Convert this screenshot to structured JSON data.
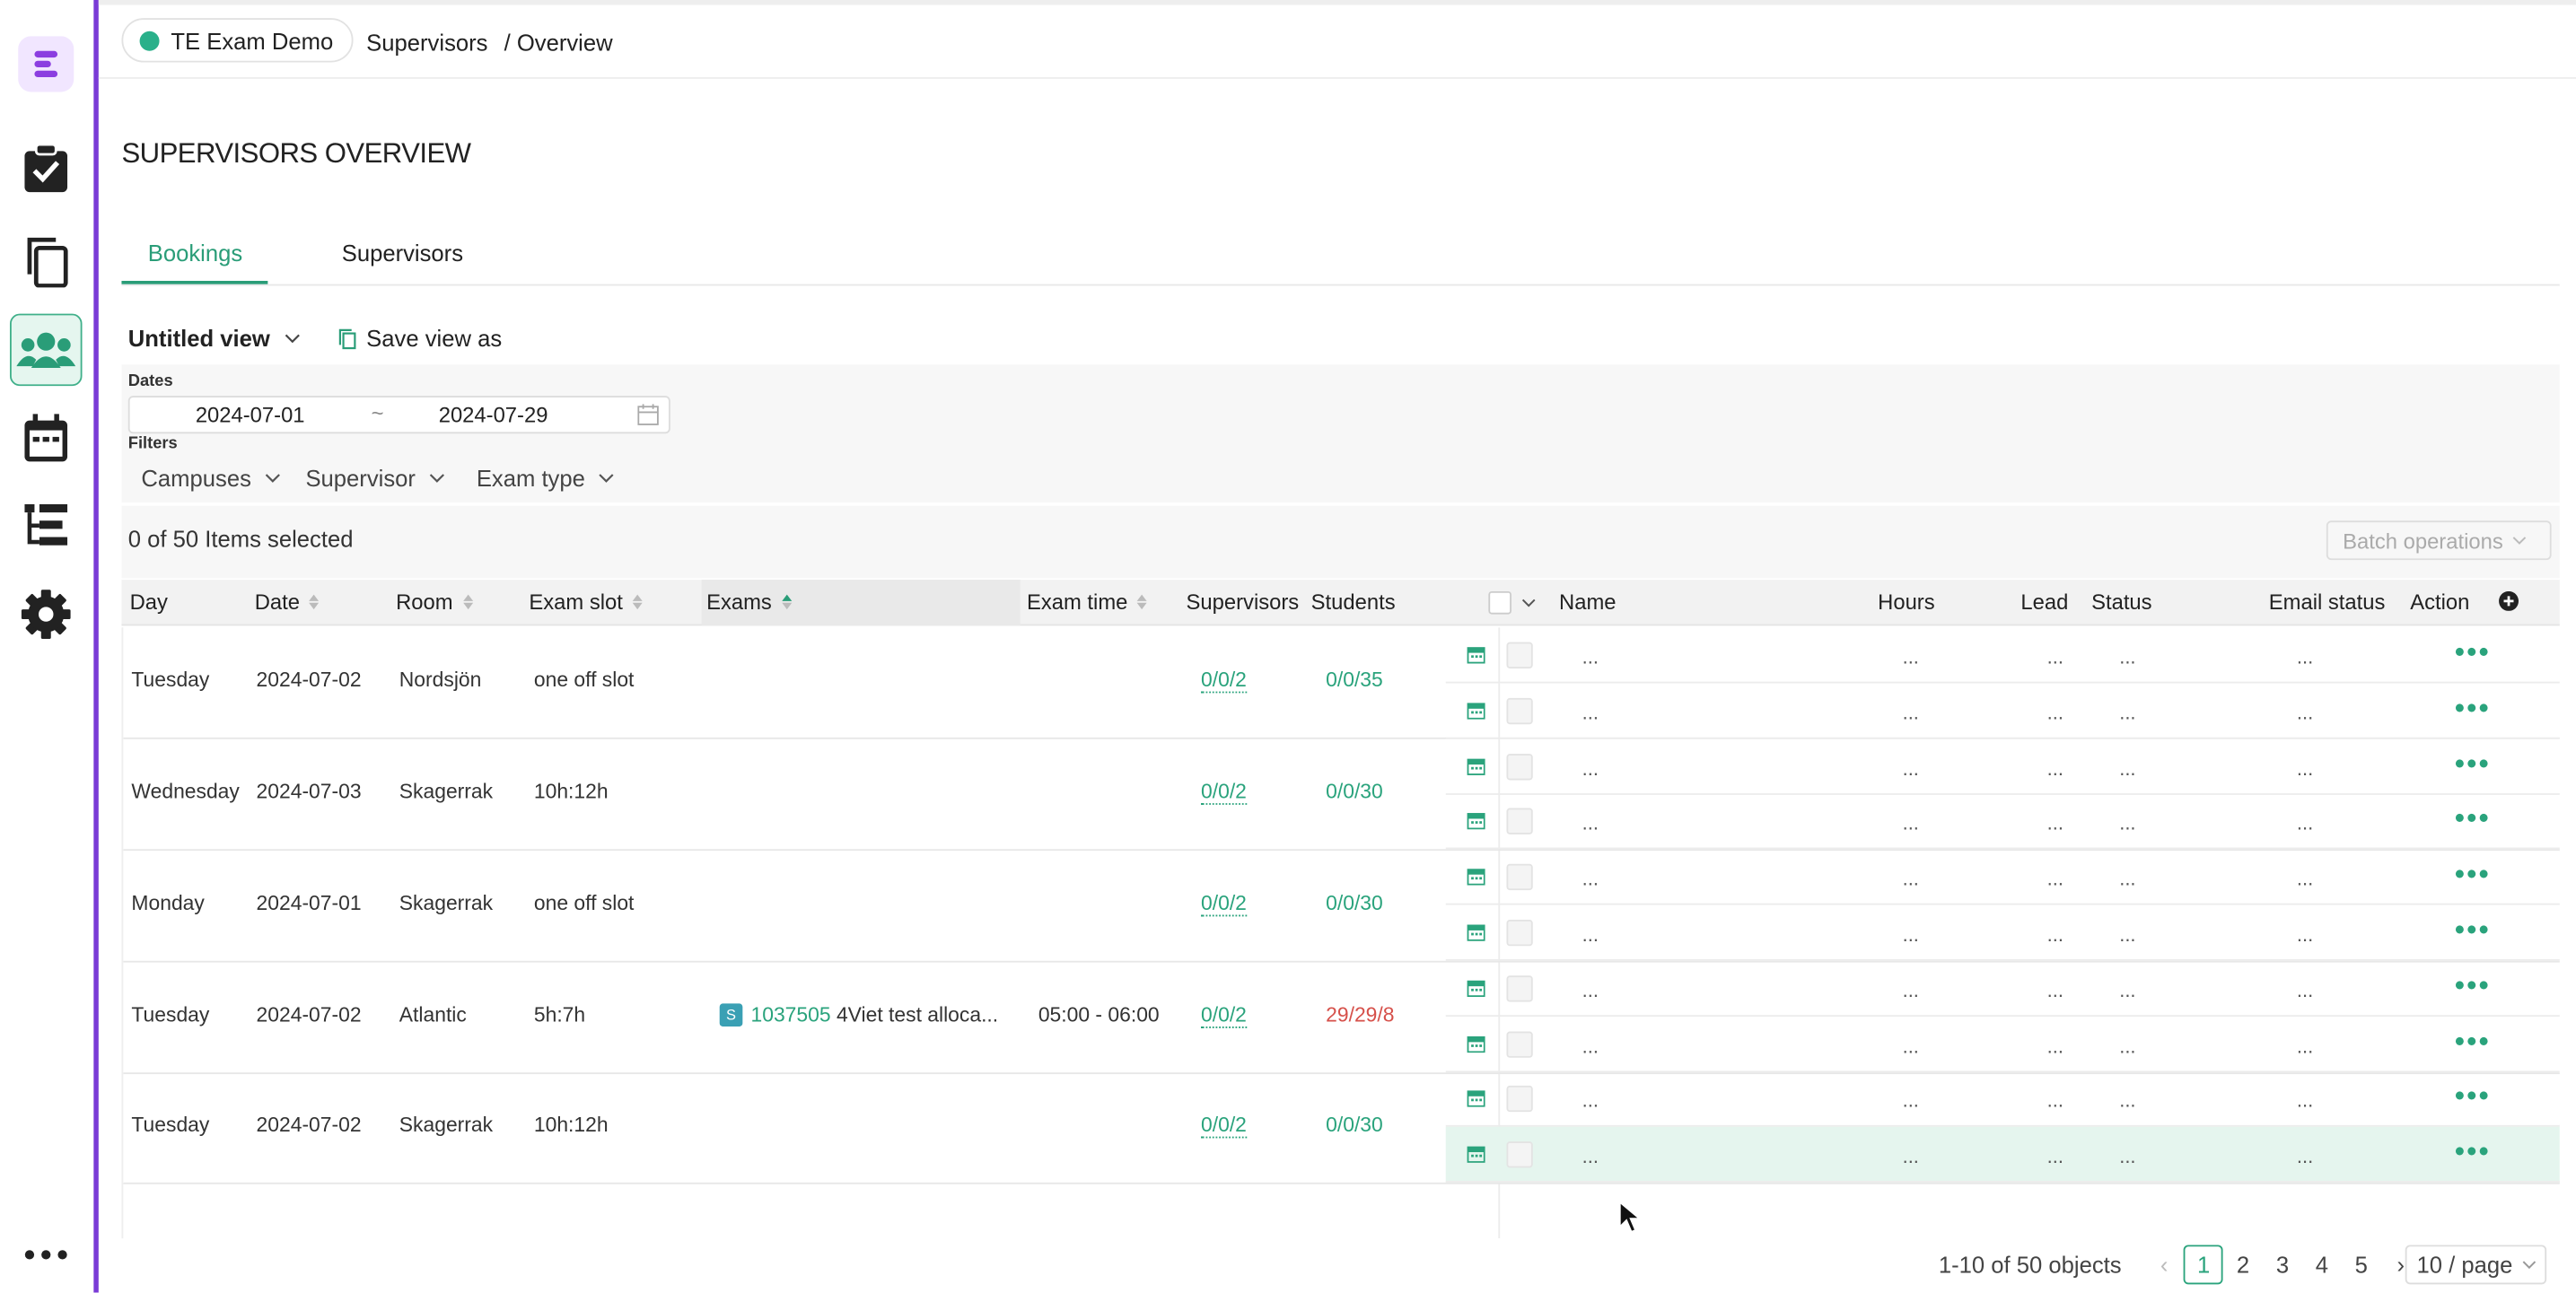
{
  "header": {
    "app_name": "TE Exam Demo",
    "breadcrumb": [
      "Supervisors",
      "/ Overview"
    ]
  },
  "sidebar": {
    "items": [
      {
        "name": "logo",
        "icon": "app-logo-icon"
      },
      {
        "name": "exams",
        "icon": "clipboard-check-icon"
      },
      {
        "name": "copies",
        "icon": "copy-icon"
      },
      {
        "name": "supervisors",
        "icon": "users-icon",
        "active": true
      },
      {
        "name": "calendar",
        "icon": "calendar-icon"
      },
      {
        "name": "hierarchy",
        "icon": "tree-list-icon"
      },
      {
        "name": "settings",
        "icon": "gear-icon"
      },
      {
        "name": "more",
        "icon": "more-icon"
      }
    ]
  },
  "page": {
    "title": "SUPERVISORS OVERVIEW",
    "tabs": [
      {
        "label": "Bookings",
        "active": true
      },
      {
        "label": "Supervisors",
        "active": false
      }
    ]
  },
  "view": {
    "name": "Untitled view",
    "save_label": "Save view as"
  },
  "filters": {
    "dates_label": "Dates",
    "date_from": "2024-07-01",
    "date_sep": "~",
    "date_to": "2024-07-29",
    "filters_label": "Filters",
    "selects": [
      "Campuses",
      "Supervisor",
      "Exam type"
    ]
  },
  "selection": {
    "text": "0 of 50 Items selected",
    "batch_label": "Batch operations"
  },
  "table": {
    "columns": [
      "Day",
      "Date",
      "Room",
      "Exam slot",
      "Exams",
      "Exam time",
      "Supervisors",
      "Students",
      "Name",
      "Hours",
      "Lead",
      "Status",
      "Email status",
      "Action"
    ],
    "placeholder": "...",
    "more_glyph": "•••",
    "rows": [
      {
        "day": "Tuesday",
        "date": "2024-07-02",
        "room": "Nordsjön",
        "slot": "one off slot",
        "exam_badge": "",
        "exam_id": "",
        "exam_name": "",
        "time": "",
        "supervisors": "0/0/2",
        "students": "0/0/35",
        "students_alert": false
      },
      {
        "day": "Wednesday",
        "date": "2024-07-03",
        "room": "Skagerrak",
        "slot": "10h:12h",
        "exam_badge": "",
        "exam_id": "",
        "exam_name": "",
        "time": "",
        "supervisors": "0/0/2",
        "students": "0/0/30",
        "students_alert": false
      },
      {
        "day": "Monday",
        "date": "2024-07-01",
        "room": "Skagerrak",
        "slot": "one off slot",
        "exam_badge": "",
        "exam_id": "",
        "exam_name": "",
        "time": "",
        "supervisors": "0/0/2",
        "students": "0/0/30",
        "students_alert": false
      },
      {
        "day": "Tuesday",
        "date": "2024-07-02",
        "room": "Atlantic",
        "slot": "5h:7h",
        "exam_badge": "S",
        "exam_id": "1037505",
        "exam_name": "4Viet test alloca...",
        "time": "05:00 - 06:00",
        "supervisors": "0/0/2",
        "students": "29/29/8",
        "students_alert": true
      },
      {
        "day": "Tuesday",
        "date": "2024-07-02",
        "room": "Skagerrak",
        "slot": "10h:12h",
        "exam_badge": "",
        "exam_id": "",
        "exam_name": "",
        "time": "",
        "supervisors": "0/0/2",
        "students": "0/0/30",
        "students_alert": false
      }
    ]
  },
  "pagination": {
    "summary": "1-10 of 50 objects",
    "pages": [
      "1",
      "2",
      "3",
      "4",
      "5"
    ],
    "current": "1",
    "page_size": "10 / page"
  },
  "colors": {
    "accent": "#2a9d78",
    "sidebar_border": "#7a3bd6",
    "alert": "#d6504a"
  }
}
